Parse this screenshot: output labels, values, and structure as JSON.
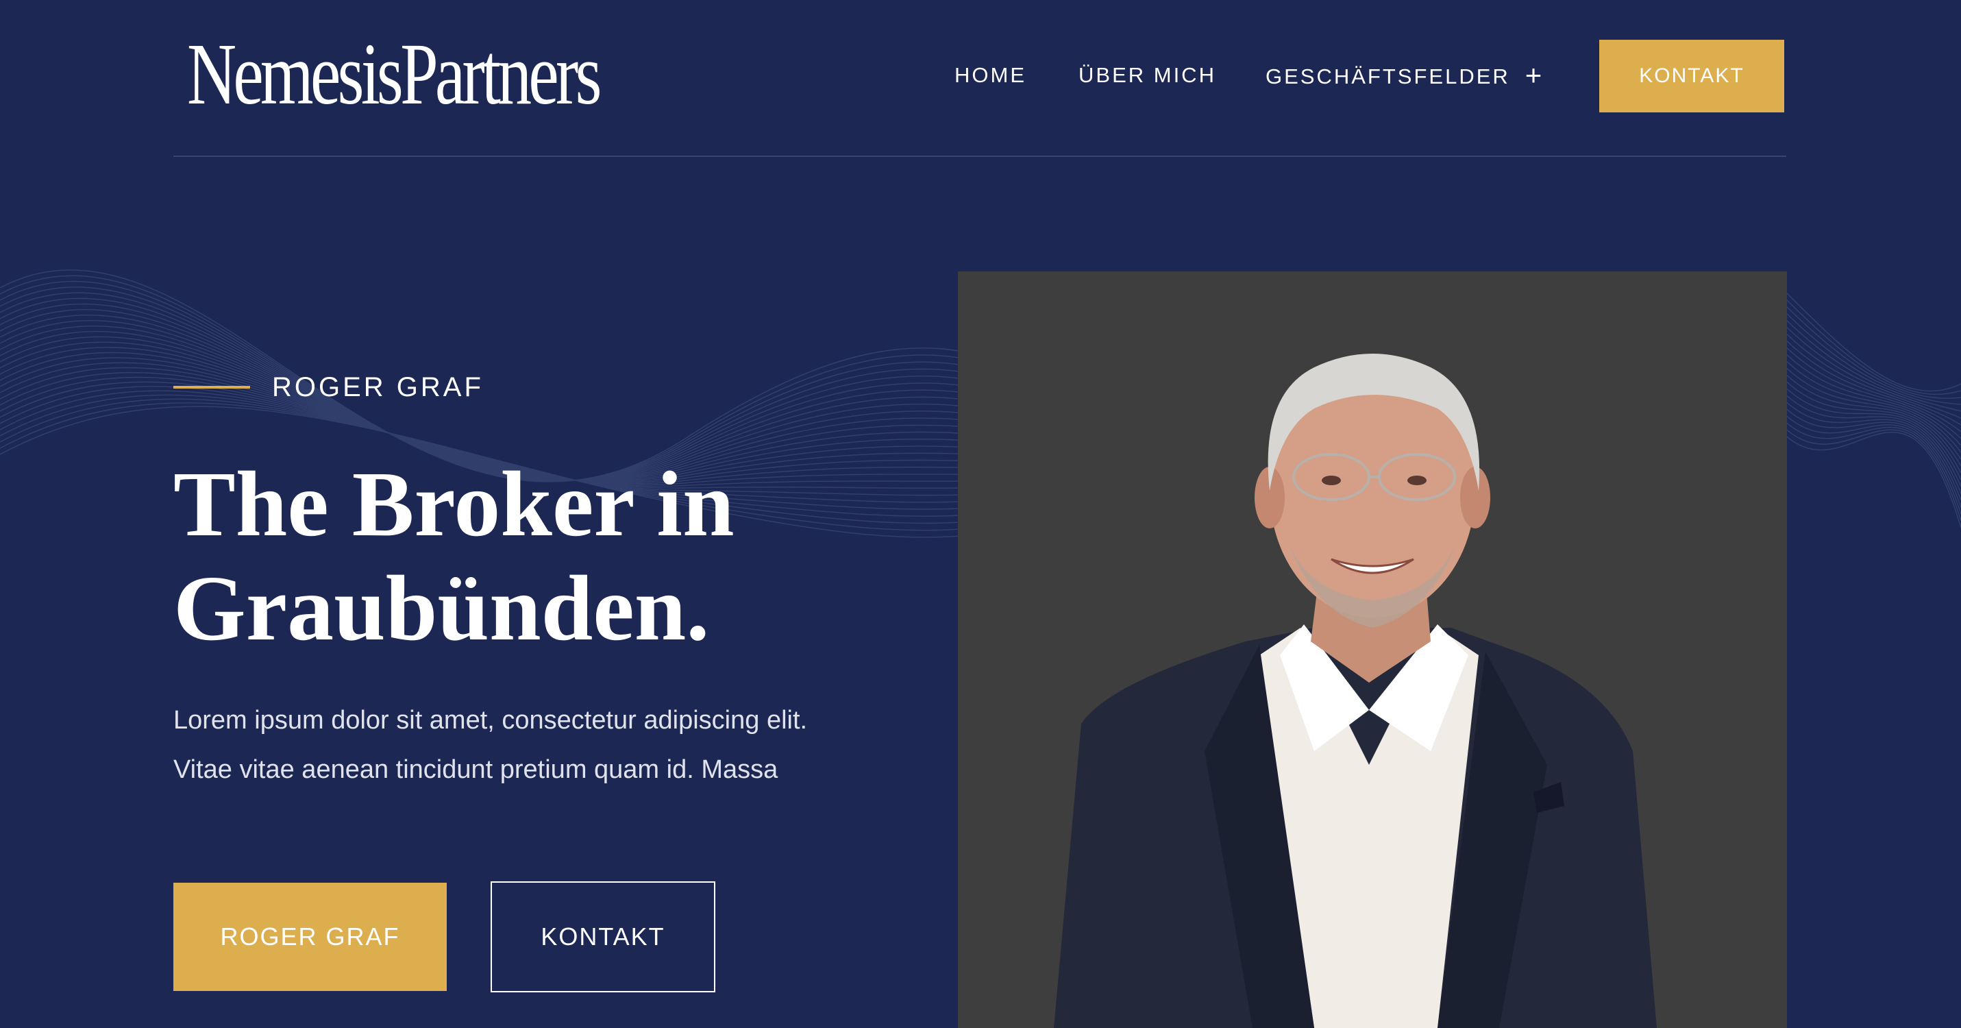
{
  "header": {
    "logo": "NemesisPartners",
    "nav": [
      "HOME",
      "ÜBER MICH",
      "GESCHÄFTSFELDER"
    ],
    "cta_label": "KONTAKT"
  },
  "hero": {
    "eyebrow": "ROGER GRAF",
    "title_lines": [
      "The Broker in",
      "Graubünden."
    ],
    "body_lines": [
      "Lorem ipsum dolor sit amet, consectetur adipiscing elit.",
      "Vitae vitae aenean tincidunt pretium quam id. Massa"
    ],
    "primary_button": "ROGER GRAF",
    "secondary_button": "KONTAKT"
  },
  "colors": {
    "background": "#1c2754",
    "accent": "#dcae4e",
    "portrait_bg": "#3e3e3e"
  },
  "icons": {
    "nav_expand": "plus-icon"
  }
}
